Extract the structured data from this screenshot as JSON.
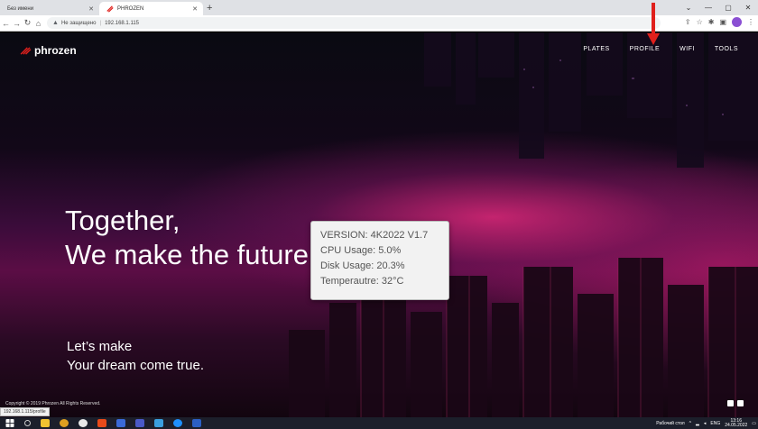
{
  "browser": {
    "tabs": [
      {
        "label": "Без имени",
        "active": false
      },
      {
        "label": "PHROZEN",
        "active": true
      }
    ],
    "new_tab": "+",
    "window_controls": [
      "⌄",
      "—",
      "▢",
      "✕"
    ],
    "address": {
      "warning": "Не защищено",
      "url": "192.168.1.115"
    }
  },
  "site": {
    "logo_text": "phrozen",
    "nav": [
      {
        "label": "PLATES"
      },
      {
        "label": "PROFILE"
      },
      {
        "label": "WIFI"
      },
      {
        "label": "TOOLS"
      }
    ],
    "hero_line1": "Together,",
    "hero_line2": "We make the future",
    "sub_line1": "Let’s make",
    "sub_line2": "Your dream come true.",
    "copyright": "Copyright © 2019 Phrozen All Rights Reserved.",
    "status_url": "192.168.1.115/profile"
  },
  "popup": {
    "version": "VERSION: 4K2022 V1.7",
    "cpu": "CPU Usage: 5.0%",
    "disk": "Disk Usage: 20.3%",
    "temp": "Temperautre: 32°C"
  },
  "taskbar": {
    "desktop_label": "Рабочий стол",
    "lang": "ENG",
    "time": "13:16",
    "date": "24.05.2022"
  },
  "colors": {
    "accent_red": "#e0201c",
    "taskbar": "#1c1f2b"
  }
}
